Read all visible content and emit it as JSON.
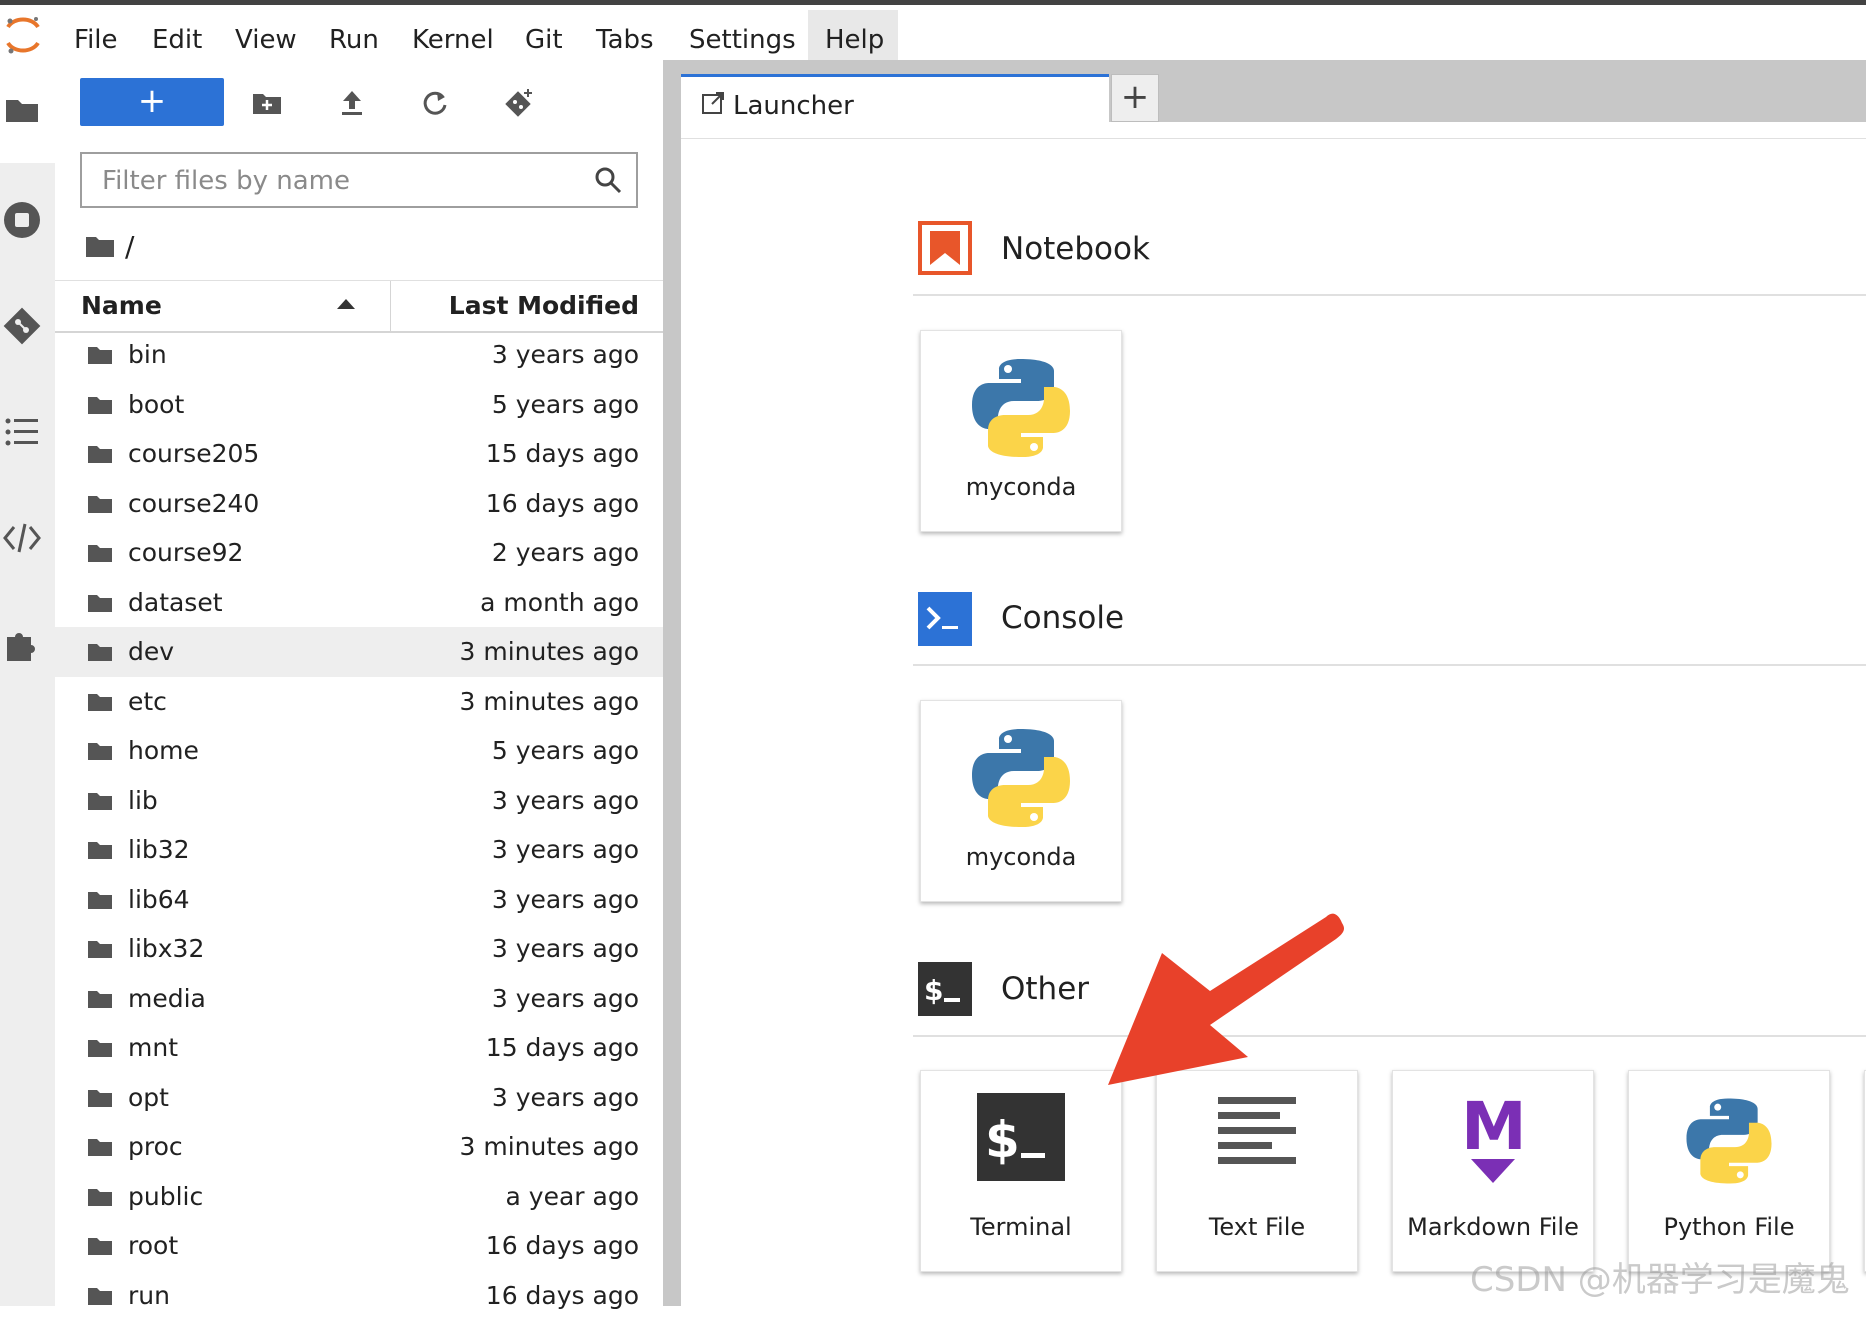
{
  "menubar": {
    "items": [
      "File",
      "Edit",
      "View",
      "Run",
      "Kernel",
      "Git",
      "Tabs",
      "Settings",
      "Help"
    ],
    "active": "Help"
  },
  "activity_bar": {
    "icons": [
      "folder-icon",
      "running-icon",
      "git-icon",
      "toc-icon",
      "property-inspector-icon",
      "extension-icon"
    ]
  },
  "file_browser": {
    "new_label": "+",
    "toolbar_icons": [
      "new-folder-icon",
      "upload-icon",
      "refresh-icon",
      "git-clone-icon"
    ],
    "filter_placeholder": "Filter files by name",
    "breadcrumb": "/",
    "columns": {
      "name": "Name",
      "modified": "Last Modified"
    },
    "files": [
      {
        "name": "bin",
        "modified": "3 years ago"
      },
      {
        "name": "boot",
        "modified": "5 years ago"
      },
      {
        "name": "course205",
        "modified": "15 days ago"
      },
      {
        "name": "course240",
        "modified": "16 days ago"
      },
      {
        "name": "course92",
        "modified": "2 years ago"
      },
      {
        "name": "dataset",
        "modified": "a month ago"
      },
      {
        "name": "dev",
        "modified": "3 minutes ago",
        "selected": true
      },
      {
        "name": "etc",
        "modified": "3 minutes ago"
      },
      {
        "name": "home",
        "modified": "5 years ago"
      },
      {
        "name": "lib",
        "modified": "3 years ago"
      },
      {
        "name": "lib32",
        "modified": "3 years ago"
      },
      {
        "name": "lib64",
        "modified": "3 years ago"
      },
      {
        "name": "libx32",
        "modified": "3 years ago"
      },
      {
        "name": "media",
        "modified": "3 years ago"
      },
      {
        "name": "mnt",
        "modified": "15 days ago"
      },
      {
        "name": "opt",
        "modified": "3 years ago"
      },
      {
        "name": "proc",
        "modified": "3 minutes ago"
      },
      {
        "name": "public",
        "modified": "a year ago"
      },
      {
        "name": "root",
        "modified": "16 days ago"
      },
      {
        "name": "run",
        "modified": "16 days ago"
      }
    ]
  },
  "tabs": {
    "launcher_label": "Launcher",
    "add_label": "+"
  },
  "launcher": {
    "notebook": {
      "title": "Notebook",
      "cards": [
        "myconda"
      ]
    },
    "console": {
      "title": "Console",
      "cards": [
        "myconda"
      ]
    },
    "other": {
      "title": "Other",
      "cards": [
        "Terminal",
        "Text File",
        "Markdown File",
        "Python File"
      ]
    }
  },
  "watermark": "CSDN @机器学习是魔鬼",
  "colors": {
    "accent": "#2c72d6",
    "notebook_icon": "#e8562a",
    "markdown_icon": "#7b2fb5",
    "annotation_arrow": "#e8412a"
  }
}
